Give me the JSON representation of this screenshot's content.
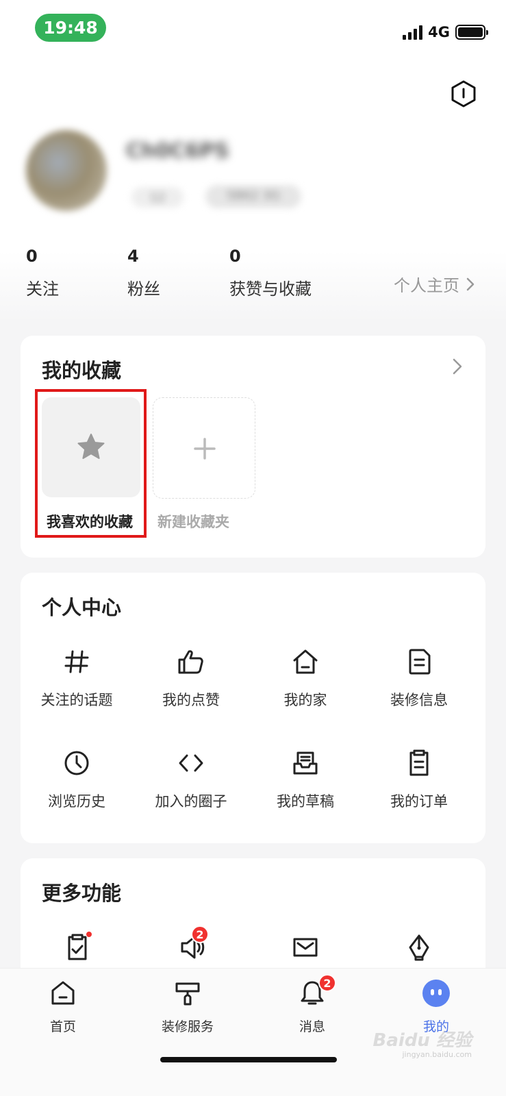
{
  "status_bar": {
    "time": "19:48",
    "network": "4G"
  },
  "profile": {
    "username": "Ch0C6PS",
    "tag_1": "12",
    "tag_2": "5B62 3G"
  },
  "stats": [
    {
      "value": "0",
      "label": "关注"
    },
    {
      "value": "4",
      "label": "粉丝"
    },
    {
      "value": "0",
      "label": "获赞与收藏"
    }
  ],
  "profile_link": "个人主页",
  "favorites": {
    "title": "我的收藏",
    "items": [
      {
        "label": "我喜欢的收藏",
        "icon": "star-icon"
      },
      {
        "label": "新建收藏夹",
        "icon": "plus-icon"
      }
    ]
  },
  "personal_center": {
    "title": "个人中心",
    "items": [
      {
        "label": "关注的话题",
        "icon": "hash-icon"
      },
      {
        "label": "我的点赞",
        "icon": "thumbs-up-icon"
      },
      {
        "label": "我的家",
        "icon": "house-icon"
      },
      {
        "label": "装修信息",
        "icon": "document-icon"
      },
      {
        "label": "浏览历史",
        "icon": "clock-icon"
      },
      {
        "label": "加入的圈子",
        "icon": "code-brackets-icon"
      },
      {
        "label": "我的草稿",
        "icon": "draft-box-icon"
      },
      {
        "label": "我的订单",
        "icon": "clipboard-icon"
      }
    ]
  },
  "more_features": {
    "title": "更多功能",
    "icons": [
      {
        "icon": "clipboard-check-icon",
        "dot": true
      },
      {
        "icon": "speaker-icon",
        "badge": "2"
      },
      {
        "icon": "mail-icon"
      },
      {
        "icon": "pen-nib-icon"
      }
    ]
  },
  "tabbar": {
    "tabs": [
      {
        "label": "首页",
        "icon": "home-icon"
      },
      {
        "label": "装修服务",
        "icon": "paint-roller-icon"
      },
      {
        "label": "消息",
        "icon": "bell-icon",
        "badge": "2"
      },
      {
        "label": "我的",
        "icon": "me-face-icon",
        "active": true
      }
    ],
    "active_color": "#4c73e8"
  },
  "watermark": {
    "text": "Baidu 经验",
    "sub": "jingyan.baidu.com"
  },
  "colors": {
    "highlight": "#e01919",
    "badge": "#f0312f",
    "status_pill": "#34b25a"
  }
}
